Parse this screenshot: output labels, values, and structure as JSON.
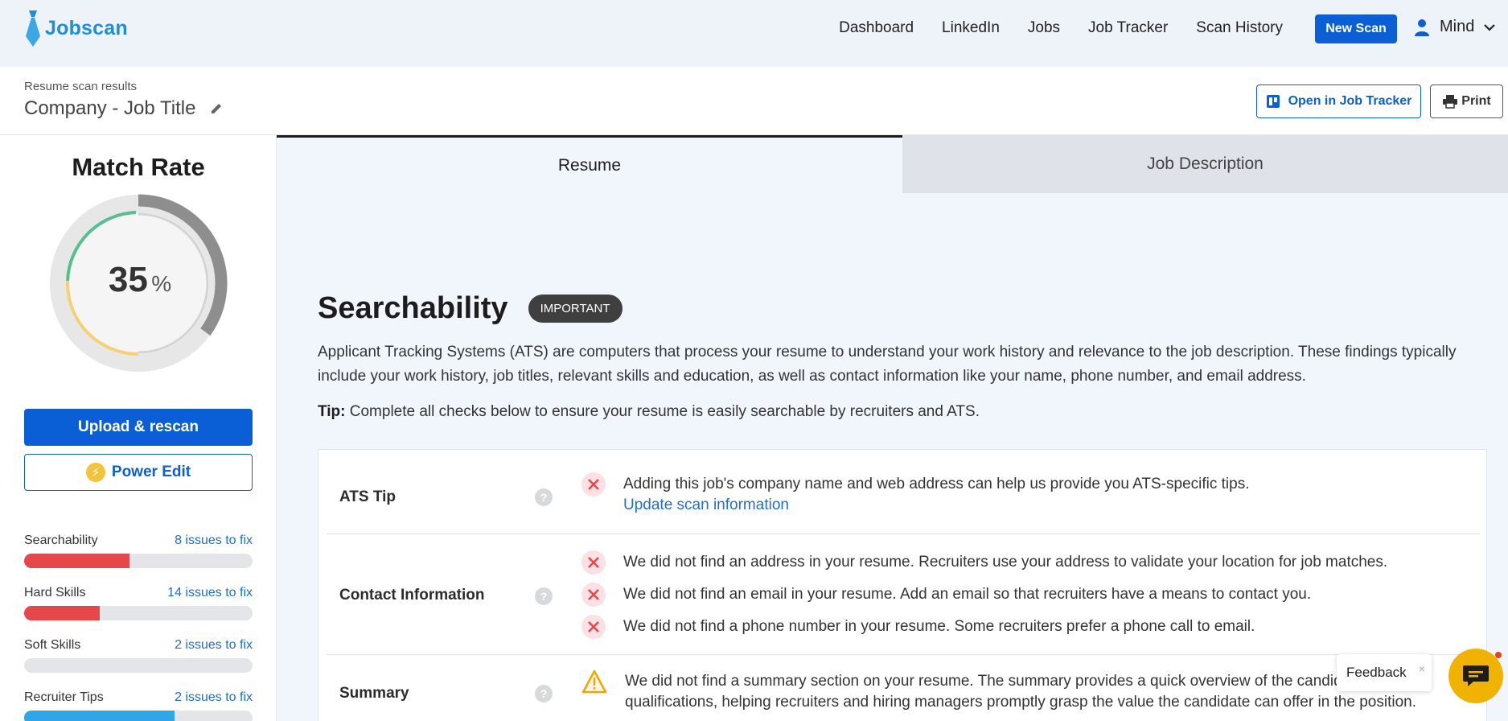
{
  "brand": {
    "name": "Jobscan",
    "color": "#1e8fd6"
  },
  "nav": {
    "links": [
      "Dashboard",
      "LinkedIn",
      "Jobs",
      "Job Tracker",
      "Scan History"
    ],
    "new_scan": "New Scan",
    "user_name": "Mind",
    "user_icon": "user-icon",
    "dropdown_icon": "chevron-down-icon"
  },
  "header": {
    "crumb": "Resume scan results",
    "title": "Company - Job Title",
    "edit_icon": "pencil-icon",
    "open_tracker": "Open in Job Tracker",
    "print": "Print"
  },
  "sidebar": {
    "match_title": "Match Rate",
    "match_value": "35",
    "match_unit": "%",
    "match_fraction": 0.35,
    "upload_rescan": "Upload & rescan",
    "power_edit": "Power Edit",
    "metrics": [
      {
        "name": "Searchability",
        "link": "8 issues to fix",
        "fill": 0.46,
        "color": "#e8474a"
      },
      {
        "name": "Hard Skills",
        "link": "14 issues to fix",
        "fill": 0.33,
        "color": "#e8474a"
      },
      {
        "name": "Soft Skills",
        "link": "2 issues to fix",
        "fill": 0.0,
        "color": "#e8474a"
      },
      {
        "name": "Recruiter Tips",
        "link": "2 issues to fix",
        "fill": 0.66,
        "color": "#2ea7e8"
      }
    ]
  },
  "tabs": {
    "resume": "Resume",
    "job_description": "Job Description"
  },
  "section": {
    "title": "Searchability",
    "badge": "IMPORTANT",
    "intro": "Applicant Tracking Systems (ATS) are computers that process your resume to understand your work history and relevance to the job description. These findings typically include your work history, job titles, relevant skills and education, as well as contact information like your name, phone number, and email address.",
    "tip_label": "Tip:",
    "tip_text": " Complete all checks below to ensure your resume is easily searchable by recruiters and ATS."
  },
  "checks": {
    "ats_tip": {
      "label": "ATS Tip",
      "text": "Adding this job's company name and web address can help us provide you ATS-specific tips.",
      "link": "Update scan information"
    },
    "contact": {
      "label": "Contact Information",
      "items": [
        "We did not find an address in your resume. Recruiters use your address to validate your location for job matches.",
        "We did not find an email in your resume. Add an email so that recruiters have a means to contact you.",
        "We did not find a phone number in your resume. Some recruiters prefer a phone call to email."
      ]
    },
    "summary": {
      "label": "Summary",
      "text": "We did not find a summary section on your resume. The summary provides a quick overview of the candidate's qualifications, helping recruiters and hiring managers promptly grasp the value the candidate can offer in the position."
    }
  },
  "feedback": {
    "label": "Feedback",
    "close": "×"
  },
  "colors": {
    "primary": "#0b5fd6",
    "error": "#e8474a",
    "warning": "#f0a500",
    "gauge_green": "#52c08f",
    "gauge_yellow": "#f6d173",
    "gauge_gray": "#8e8e8e"
  }
}
